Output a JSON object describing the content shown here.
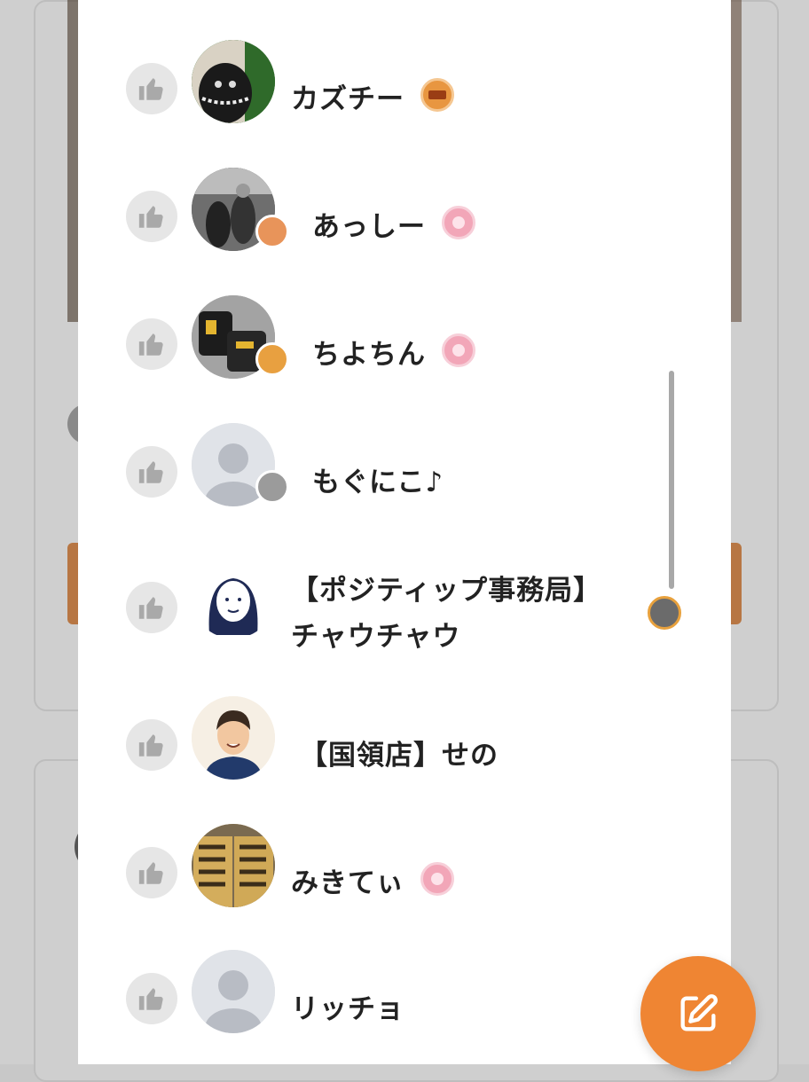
{
  "likers": [
    {
      "name": "カズチー",
      "avatar_icon": "cat-photo-avatar",
      "rank_badge": "",
      "title_badge": "thanks-festival-badge"
    },
    {
      "name": "あっしー",
      "avatar_icon": "gym-photo-avatar",
      "rank_badge": "super-rank-badge",
      "title_badge": "pink-flower-badge"
    },
    {
      "name": "ちよちん",
      "avatar_icon": "gloves-photo-avatar",
      "rank_badge": "master-rank-badge",
      "title_badge": "pink-flower-badge"
    },
    {
      "name": "もぐにこ♪",
      "avatar_icon": "default-user-avatar",
      "rank_badge": "elite-rank-badge",
      "title_badge": ""
    },
    {
      "name": "【ポジティップ事務局】チャウチャウ",
      "name_line1": "【ポジティップ事務局】",
      "name_line2": "チャウチャウ",
      "avatar_icon": "illustration-woman-avatar",
      "rank_badge": "",
      "title_badge": "tipness-staff-badge"
    },
    {
      "name": "【国領店】せの",
      "avatar_icon": "illustration-man-avatar",
      "rank_badge": "",
      "title_badge": ""
    },
    {
      "name": "みきてぃ",
      "avatar_icon": "shinkansen-photo-avatar",
      "rank_badge": "",
      "title_badge": "pink-flower-badge"
    },
    {
      "name": "リッチョ",
      "avatar_icon": "default-user-avatar",
      "rank_badge": "",
      "title_badge": ""
    }
  ],
  "colors": {
    "accent": "#ef8533",
    "like_bg": "#e6e6e6",
    "like_icon": "#a9a9a9"
  },
  "fab": {
    "icon": "edit-icon"
  }
}
